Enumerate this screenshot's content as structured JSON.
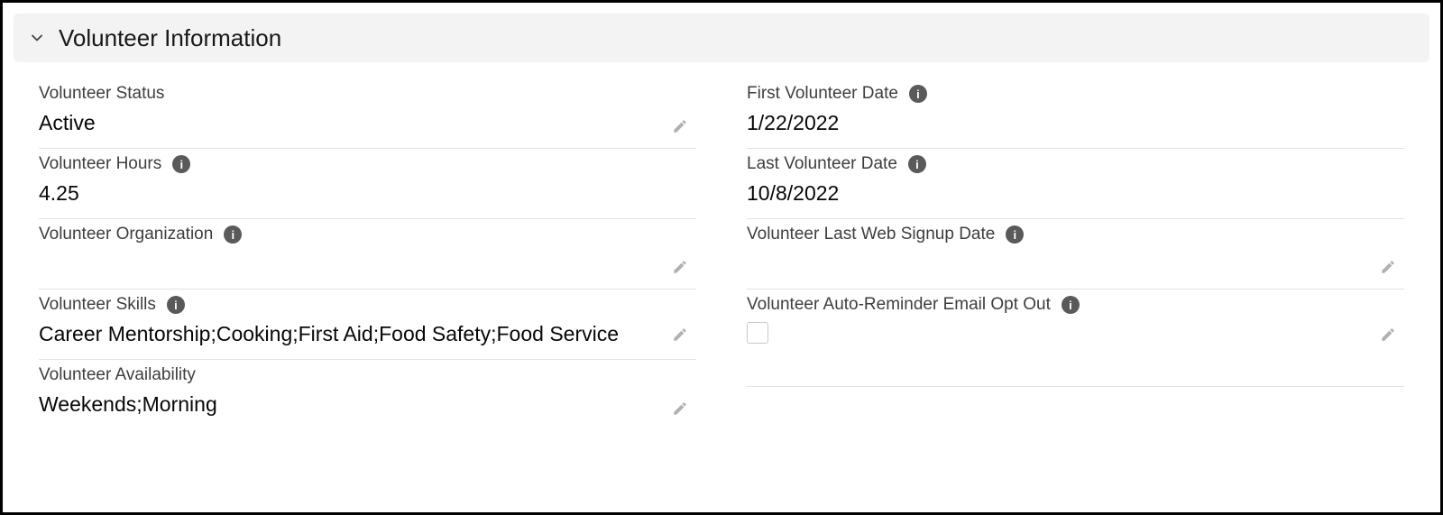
{
  "section": {
    "title": "Volunteer Information"
  },
  "left": {
    "status": {
      "label": "Volunteer Status",
      "value": "Active",
      "info": false,
      "editable": true
    },
    "hours": {
      "label": "Volunteer Hours",
      "value": "4.25",
      "info": true,
      "editable": false
    },
    "org": {
      "label": "Volunteer Organization",
      "value": "",
      "info": true,
      "editable": true
    },
    "skills": {
      "label": "Volunteer Skills",
      "value": "Career Mentorship;Cooking;First Aid;Food Safety;Food Service",
      "info": true,
      "editable": true
    },
    "availability": {
      "label": "Volunteer Availability",
      "value": "Weekends;Morning",
      "info": false,
      "editable": true
    }
  },
  "right": {
    "firstDate": {
      "label": "First Volunteer Date",
      "value": "1/22/2022",
      "info": true,
      "editable": false
    },
    "lastDate": {
      "label": "Last Volunteer Date",
      "value": "10/8/2022",
      "info": true,
      "editable": false
    },
    "lastSignup": {
      "label": "Volunteer Last Web Signup Date",
      "value": "",
      "info": true,
      "editable": true
    },
    "optOut": {
      "label": "Volunteer Auto-Reminder Email Opt Out",
      "checked": false,
      "info": true,
      "editable": true
    }
  }
}
